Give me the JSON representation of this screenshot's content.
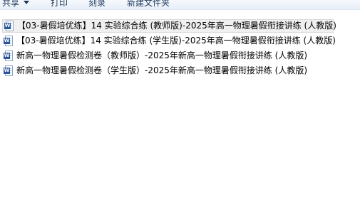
{
  "toolbar": {
    "share_label": "共享",
    "print_label": "打印",
    "burn_label": "刻录",
    "new_folder_label": "新建文件夹"
  },
  "files": [
    {
      "name": "【03-暑假培优练】14 实验综合练 (教师版)-2025年高一物理暑假衔接讲练 (人教版)",
      "icon": "word-doc-icon",
      "selected": true
    },
    {
      "name": "【03-暑假培优练】14 实验综合练 (学生版)-2025年高一物理暑假衔接讲练 (人教版)",
      "icon": "word-doc-icon",
      "selected": false
    },
    {
      "name": "新高一物理暑假检测卷（教师版）-2025年新高一物理暑假衔接讲练 (人教版)",
      "icon": "word-doc-icon",
      "selected": false
    },
    {
      "name": "新高一物理暑假检测卷（学生版）-2025年新高一物理暑假衔接讲练 (人教版)",
      "icon": "word-doc-icon",
      "selected": false
    }
  ],
  "icon_badge_letter": "W",
  "colors": {
    "toolbar_text": "#1e395b",
    "word_blue": "#2b579a",
    "selection_bg": "#f0f0f0",
    "selection_border": "#d9d9d9"
  }
}
